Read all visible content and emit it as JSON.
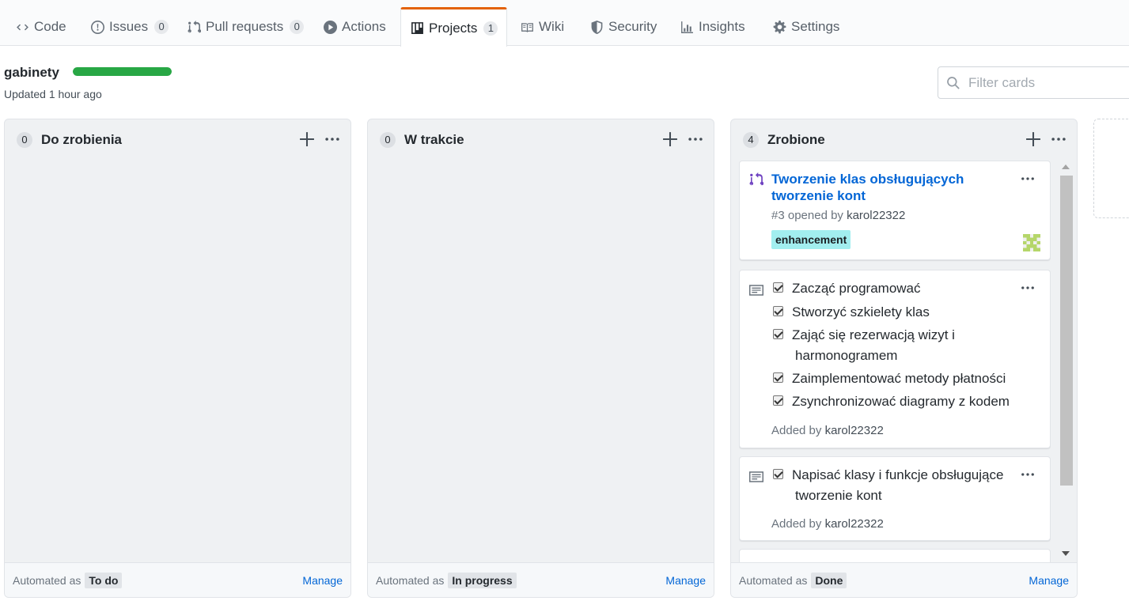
{
  "tabs": [
    {
      "label": "Code",
      "count": null,
      "icon": "code-icon"
    },
    {
      "label": "Issues",
      "count": "0",
      "icon": "issue-icon"
    },
    {
      "label": "Pull requests",
      "count": "0",
      "icon": "git-pull-request-icon"
    },
    {
      "label": "Actions",
      "count": null,
      "icon": "play-icon"
    },
    {
      "label": "Projects",
      "count": "1",
      "icon": "project-icon",
      "selected": true
    },
    {
      "label": "Wiki",
      "count": null,
      "icon": "book-icon"
    },
    {
      "label": "Security",
      "count": null,
      "icon": "shield-icon"
    },
    {
      "label": "Insights",
      "count": null,
      "icon": "graph-icon"
    },
    {
      "label": "Settings",
      "count": null,
      "icon": "gear-icon"
    }
  ],
  "project": {
    "name": "gabinety",
    "progress": 1.0,
    "updated_label": "Updated",
    "updated_time": "1 hour ago",
    "filter_placeholder": "Filter cards"
  },
  "columns": [
    {
      "count": "0",
      "title": "Do zrobienia",
      "automated_label": "Automated as",
      "automated_value": "To do",
      "manage": "Manage"
    },
    {
      "count": "0",
      "title": "W trakcie",
      "automated_label": "Automated as",
      "automated_value": "In progress",
      "manage": "Manage"
    },
    {
      "count": "4",
      "title": "Zrobione",
      "automated_label": "Automated as",
      "automated_value": "Done",
      "manage": "Manage"
    }
  ],
  "cards": {
    "issue": {
      "title": "Tworzenie klas obsługujących tworzenie kont",
      "number_text": "#3 opened by",
      "author": "karol22322",
      "label": "enhancement",
      "label_color": "#a2eeef"
    },
    "note1": {
      "tasks": [
        {
          "text": "Zacząć programować",
          "checked": true
        },
        {
          "text": "Stworzyć szkielety klas",
          "checked": true
        },
        {
          "text": "Zająć się rezerwacją wizyt i",
          "checked": true,
          "continuation": "harmonogramem"
        },
        {
          "text": "Zaimplementować metody płatności",
          "checked": true
        },
        {
          "text": "Zsynchronizować diagramy z kodem",
          "checked": true
        }
      ],
      "added_label": "Added by",
      "author": "karol22322"
    },
    "note2": {
      "tasks": [
        {
          "text": "Napisać klasy i funkcje obsługujące",
          "checked": true,
          "continuation": "tworzenie kont"
        }
      ],
      "added_label": "Added by",
      "author": "karol22322"
    }
  },
  "colors": {
    "accent": "#0366d6",
    "selected_tab_border": "#e36209",
    "progress": "#28a745"
  }
}
